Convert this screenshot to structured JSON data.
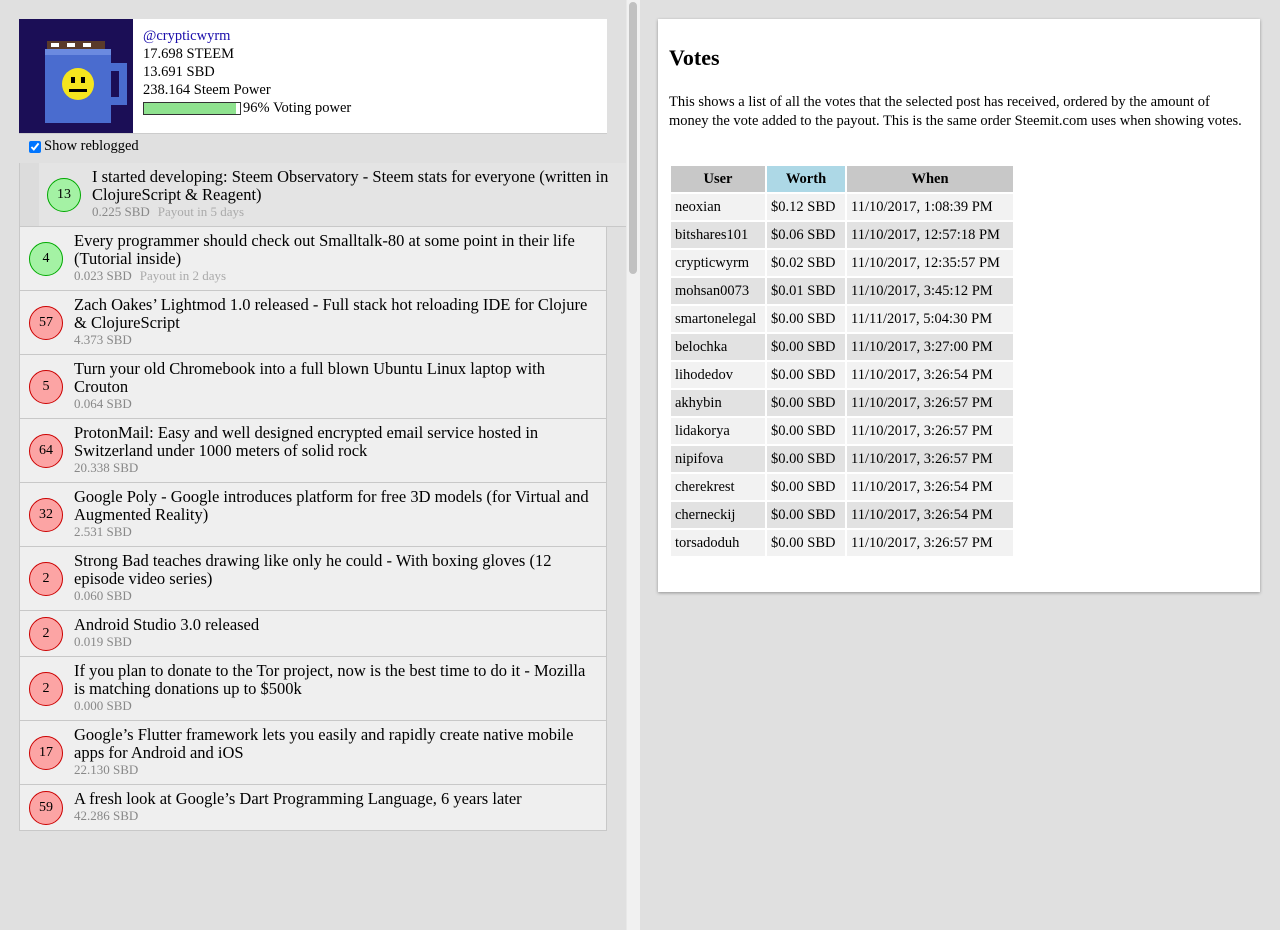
{
  "profile": {
    "username": "@crypticwyrm",
    "steem": "17.698 STEEM",
    "sbd": "13.691 SBD",
    "steem_power": "238.164 Steem Power",
    "voting_power_label": "96% Voting power",
    "voting_power_fraction": 0.96
  },
  "show_reblogged_label": "Show reblogged",
  "posts": [
    {
      "votes": "13",
      "title": "I started developing: Steem Observatory - Steem stats for everyone (written in ClojureScript & Reagent)",
      "amount": "0.225 SBD",
      "payout": "Payout in 5 days",
      "color": "green"
    },
    {
      "votes": "4",
      "title": "Every programmer should check out Smalltalk-80 at some point in their life (Tutorial inside)",
      "amount": "0.023 SBD",
      "payout": "Payout in 2 days",
      "color": "green"
    },
    {
      "votes": "57",
      "title": "Zach Oakes’ Lightmod 1.0 released - Full stack hot reloading IDE for Clojure & ClojureScript",
      "amount": "4.373 SBD",
      "payout": "",
      "color": "red"
    },
    {
      "votes": "5",
      "title": "Turn your old Chromebook into a full blown Ubuntu Linux laptop with Crouton",
      "amount": "0.064 SBD",
      "payout": "",
      "color": "red"
    },
    {
      "votes": "64",
      "title": "ProtonMail: Easy and well designed encrypted email service hosted in Switzerland under 1000 meters of solid rock",
      "amount": "20.338 SBD",
      "payout": "",
      "color": "red"
    },
    {
      "votes": "32",
      "title": "Google Poly - Google introduces platform for free 3D models (for Virtual and Augmented Reality)",
      "amount": "2.531 SBD",
      "payout": "",
      "color": "red"
    },
    {
      "votes": "2",
      "title": "Strong Bad teaches drawing like only he could - With boxing gloves (12 episode video series)",
      "amount": "0.060 SBD",
      "payout": "",
      "color": "red"
    },
    {
      "votes": "2",
      "title": "Android Studio 3.0 released",
      "amount": "0.019 SBD",
      "payout": "",
      "color": "red"
    },
    {
      "votes": "2",
      "title": "If you plan to donate to the Tor project, now is the best time to do it - Mozilla is matching donations up to $500k",
      "amount": "0.000 SBD",
      "payout": "",
      "color": "red"
    },
    {
      "votes": "17",
      "title": "Google’s Flutter framework lets you easily and rapidly create native mobile apps for Android and iOS",
      "amount": "22.130 SBD",
      "payout": "",
      "color": "red"
    },
    {
      "votes": "59",
      "title": "A fresh look at Google’s Dart Programming Language, 6 years later",
      "amount": "42.286 SBD",
      "payout": "",
      "color": "red"
    }
  ],
  "votes_panel": {
    "title": "Votes",
    "description": "This shows a list of all the votes that the selected post has received, ordered by the amount of money the vote added to the payout. This is the same order Steemit.com uses when showing votes.",
    "headers": {
      "user": "User",
      "worth": "Worth",
      "when": "When"
    },
    "rows": [
      {
        "user": "neoxian",
        "worth": "$0.12 SBD",
        "when": "11/10/2017, 1:08:39 PM"
      },
      {
        "user": "bitshares101",
        "worth": "$0.06 SBD",
        "when": "11/10/2017, 12:57:18 PM"
      },
      {
        "user": "crypticwyrm",
        "worth": "$0.02 SBD",
        "when": "11/10/2017, 12:35:57 PM"
      },
      {
        "user": "mohsan0073",
        "worth": "$0.01 SBD",
        "when": "11/10/2017, 3:45:12 PM"
      },
      {
        "user": "smartonelegal",
        "worth": "$0.00 SBD",
        "when": "11/11/2017, 5:04:30 PM"
      },
      {
        "user": "belochka",
        "worth": "$0.00 SBD",
        "when": "11/10/2017, 3:27:00 PM"
      },
      {
        "user": "lihodedov",
        "worth": "$0.00 SBD",
        "when": "11/10/2017, 3:26:54 PM"
      },
      {
        "user": "akhybin",
        "worth": "$0.00 SBD",
        "when": "11/10/2017, 3:26:57 PM"
      },
      {
        "user": "lidakorya",
        "worth": "$0.00 SBD",
        "when": "11/10/2017, 3:26:57 PM"
      },
      {
        "user": "nipifova",
        "worth": "$0.00 SBD",
        "when": "11/10/2017, 3:26:57 PM"
      },
      {
        "user": "cherekrest",
        "worth": "$0.00 SBD",
        "when": "11/10/2017, 3:26:54 PM"
      },
      {
        "user": "cherneckij",
        "worth": "$0.00 SBD",
        "when": "11/10/2017, 3:26:54 PM"
      },
      {
        "user": "torsadoduh",
        "worth": "$0.00 SBD",
        "when": "11/10/2017, 3:26:57 PM"
      }
    ]
  }
}
